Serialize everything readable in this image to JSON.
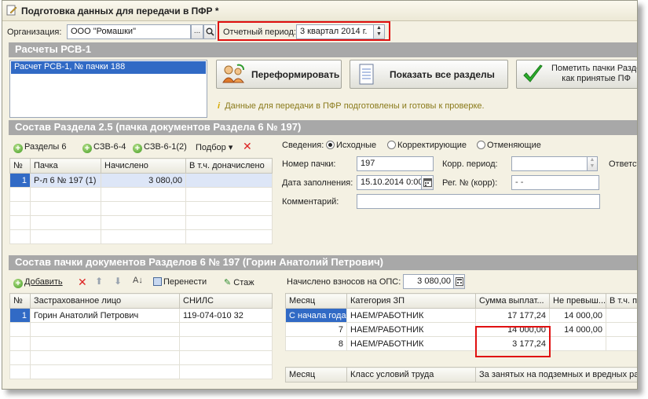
{
  "window": {
    "title": "Подготовка данных для передачи в ПФР *"
  },
  "org": {
    "label": "Организация:",
    "value": "ООО \"Ромашки\"",
    "dots": "...",
    "search_icon": "search-icon"
  },
  "period": {
    "label": "Отчетный период:",
    "value": "3 квартал 2014 г."
  },
  "rsv": {
    "section_title": "Расчеты РСВ-1",
    "list": [
      "Расчет РСВ-1, № пачки 188"
    ],
    "reform_button": "Переформировать",
    "show_all_button": "Показать все разделы",
    "mark_button_line1": "Пометить пачки Разде",
    "mark_button_line2": "как принятые ПФ",
    "info": "Данные для передачи в ПФР подготовлены и готовы к проверке."
  },
  "section25": {
    "title": "Состав Раздела 2.5     (пачка документов Раздела 6 № 197)",
    "toolbar": {
      "razd6": "Разделы 6",
      "szv64": "СЗВ-6-4",
      "szv612": "СЗВ-6-1(2)",
      "podbor": "Подбор",
      "podbor_arrow": "▾"
    },
    "columns": [
      "№",
      "Пачка",
      "Начислено",
      "В т.ч. доначислено"
    ],
    "rows": [
      {
        "n": "1",
        "pack": "Р-л 6 № 197 (1)",
        "amount": "3 080,00",
        "extra": ""
      }
    ],
    "svedeniya_label": "Сведения:",
    "radio": [
      "Исходные",
      "Корректирующие",
      "Отменяющие"
    ],
    "pack_no_label": "Номер пачки:",
    "pack_no_value": "197",
    "corr_period_label": "Корр. период:",
    "corr_period_value": "",
    "resp_label": "Ответст",
    "date_label": "Дата заполнения:",
    "date_value": "15.10.2014  0:00",
    "reg_label": "Рег. № (корр):",
    "reg_value": "-  -",
    "comment_label": "Комментарий:",
    "comment_value": ""
  },
  "section6": {
    "title": "Состав пачки документов Разделов 6 № 197          (Горин Анатолий Петрович)",
    "toolbar": {
      "add": "Добавить",
      "move": "Перенести",
      "stazh": "Стаж"
    },
    "columns": [
      "№",
      "Застрахованное лицо",
      "СНИЛС"
    ],
    "rows": [
      {
        "n": "1",
        "name": "Горин Анатолий Петрович",
        "snils": "119-074-010 32"
      }
    ],
    "ops_label": "Начислено взносов на ОПС:",
    "ops_value": "3 080,00",
    "pay_columns": [
      "Месяц",
      "Категория ЗП",
      "Сумма выплат...",
      "Не превыш...",
      "В т.ч. пр"
    ],
    "pay_rows": [
      {
        "month": "С начала года",
        "cat": "НАЕМ/РАБОТНИК",
        "sum": "17 177,24",
        "notexc": "14 000,00",
        "incl": ""
      },
      {
        "month": "7",
        "cat": "НАЕМ/РАБОТНИК",
        "sum": "14 000,00",
        "notexc": "14 000,00",
        "incl": ""
      },
      {
        "month": "8",
        "cat": "НАЕМ/РАБОТНИК",
        "sum": "3 177,24",
        "notexc": "",
        "incl": ""
      }
    ],
    "cond_columns": [
      "Месяц",
      "Класс условий труда",
      "За занятых на подземных и вредных ра..."
    ]
  },
  "colors": {
    "section_bg": "#a8a8a8",
    "window_bg": "#f4f1e3",
    "selection": "#316ac5",
    "highlight_box": "#e01010"
  }
}
